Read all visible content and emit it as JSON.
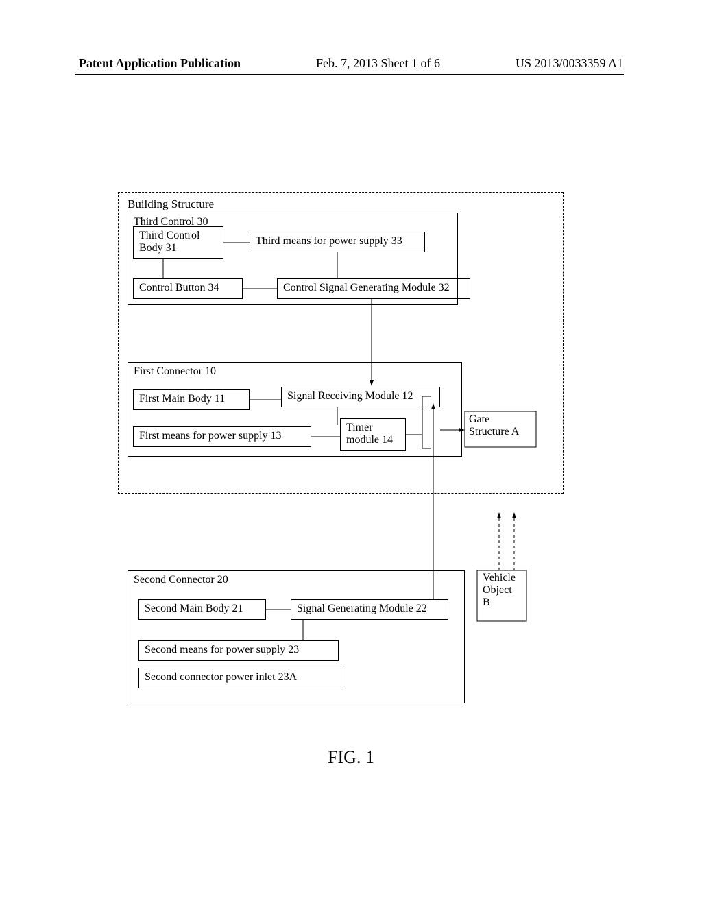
{
  "header": {
    "left": "Patent Application Publication",
    "mid": "Feb. 7, 2013  Sheet 1 of 6",
    "right": "US 2013/0033359 A1"
  },
  "building_label": "Building Structure",
  "third_control": {
    "title": "Third Control 30",
    "body": "Third Control Body 31",
    "power": "Third means for power supply 33",
    "button": "Control Button 34",
    "signal_gen": "Control Signal Generating Module 32"
  },
  "first_connector": {
    "title": "First Connector 10",
    "body": "First Main Body 11",
    "signal_recv": "Signal Receiving Module 12",
    "power": "First means for power supply 13",
    "timer": "Timer module 14"
  },
  "gate": {
    "line1": "Gate",
    "line2": "Structure A"
  },
  "second_connector": {
    "title": "Second Connector 20",
    "body": "Second Main Body 21",
    "signal_gen": "Signal Generating Module 22",
    "power": "Second means for power supply 23",
    "inlet": "Second connector power inlet 23A"
  },
  "vehicle": {
    "line1": "Vehicle",
    "line2": "Object",
    "line3": "B"
  },
  "figure_caption": "FIG. 1"
}
